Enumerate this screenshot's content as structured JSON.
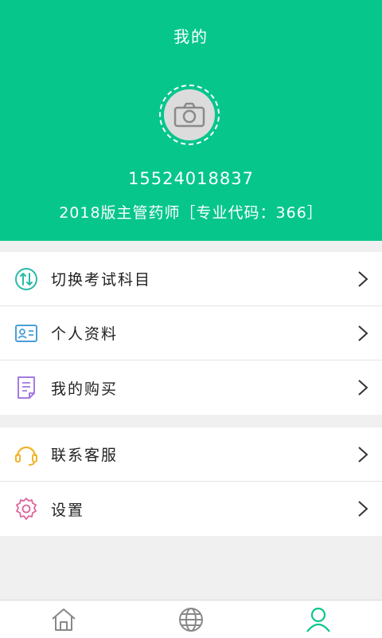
{
  "header": {
    "title": "我的",
    "phone": "15524018837",
    "subject": "2018版主管药师［专业代码：366］",
    "avatar_icon": "camera-icon",
    "bg_color": "#06c68c"
  },
  "menu_group_1": [
    {
      "label": "切换考试科目",
      "icon": "switch-icon",
      "color": "#2bb9a8"
    },
    {
      "label": "个人资料",
      "icon": "id-card-icon",
      "color": "#4a9fd8"
    },
    {
      "label": "我的购买",
      "icon": "document-icon",
      "color": "#a37be0"
    }
  ],
  "menu_group_2": [
    {
      "label": "联系客服",
      "icon": "headset-icon",
      "color": "#f0b42a"
    },
    {
      "label": "设置",
      "icon": "gear-icon",
      "color": "#e0629a"
    }
  ],
  "bottom_nav": [
    {
      "icon": "home-icon",
      "active": false
    },
    {
      "icon": "globe-icon",
      "active": false
    },
    {
      "icon": "user-icon",
      "active": true,
      "active_color": "#06c68c"
    }
  ]
}
